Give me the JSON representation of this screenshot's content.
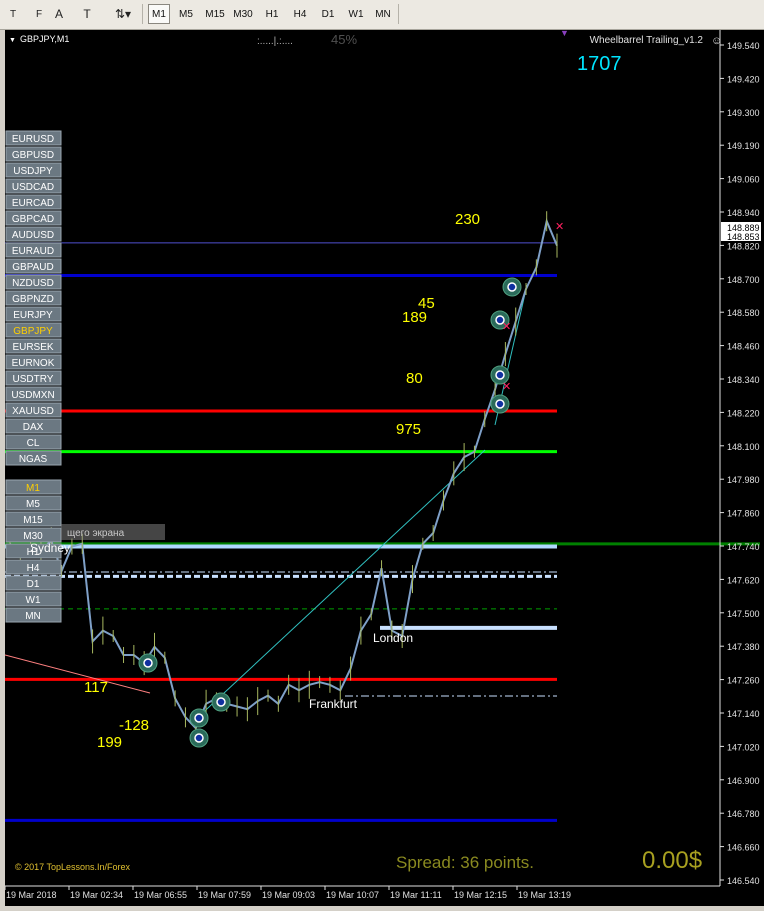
{
  "toolbar": {
    "tools": [
      {
        "icon": "text-label-icon",
        "glyph": "T"
      },
      {
        "icon": "fibonacci-icon",
        "glyph": "F"
      },
      {
        "icon": "text-icon",
        "glyph": "A"
      },
      {
        "icon": "text-box-icon",
        "glyph": "T"
      },
      {
        "icon": "arrows-dropdown-icon",
        "glyph": "⇅▾"
      }
    ],
    "timeframes": [
      "M1",
      "M5",
      "M15",
      "M30",
      "H1",
      "H4",
      "D1",
      "W1",
      "MN"
    ],
    "active_timeframe": "M1"
  },
  "chart": {
    "symbol": "GBPJPY,M1",
    "progress_label": "45%",
    "indicator": "Wheelbarrel Trailing_v1.2",
    "counter": "1707",
    "spread": "Spread: 36 points.",
    "profit": "0.00$",
    "copyright": "© 2017 TopLessons.In/Forex",
    "colors": {
      "background": "#000000",
      "candles": "#7fa0c8",
      "text_yellow": "#ffff00",
      "counter": "#00e5ff",
      "spread": "#8a8a20",
      "profit": "#a8a020"
    }
  },
  "symbols": [
    "EURUSD",
    "GBPUSD",
    "USDJPY",
    "USDCAD",
    "EURCAD",
    "GBPCAD",
    "AUDUSD",
    "EURAUD",
    "GBPAUD",
    "NZDUSD",
    "GBPNZD",
    "EURJPY",
    "GBPJPY",
    "EURSEK",
    "EURNOK",
    "USDTRY",
    "USDMXN",
    "XAUUSD",
    "DAX",
    "CL",
    "NGAS"
  ],
  "active_symbol": "GBPJPY",
  "timeframe_buttons": [
    "M1",
    "M5",
    "M15",
    "M30",
    "H1",
    "H4",
    "D1",
    "W1",
    "MN"
  ],
  "active_timeframe_button": "M1",
  "sessions": [
    "Sydney",
    "London",
    "Frankfurt"
  ],
  "hidden_text": "щего экрана",
  "chart_labels": [
    {
      "text": "230"
    },
    {
      "text": "45"
    },
    {
      "text": "189"
    },
    {
      "text": "80"
    },
    {
      "text": "975"
    },
    {
      "text": "117"
    },
    {
      "text": "-128"
    },
    {
      "text": "199"
    }
  ],
  "price_axis": [
    "149.540",
    "149.420",
    "149.300",
    "149.190",
    "149.060",
    "148.940",
    "148.820",
    "148.700",
    "148.580",
    "148.460",
    "148.340",
    "148.220",
    "148.100",
    "147.980",
    "147.860",
    "147.740",
    "147.620",
    "147.500",
    "147.380",
    "147.260",
    "147.140",
    "147.020",
    "146.900",
    "146.780",
    "146.660",
    "146.540"
  ],
  "price_markers": [
    "148.889",
    "148.853"
  ],
  "time_axis": [
    "19 Mar 2018",
    "19 Mar 02:34",
    "19 Mar 06:55",
    "19 Mar 07:59",
    "19 Mar 09:03",
    "19 Mar 10:07",
    "19 Mar 11:11",
    "19 Mar 12:15",
    "19 Mar 13:19"
  ],
  "chart_data": {
    "type": "line",
    "symbol": "GBPJPY",
    "timeframe": "M1",
    "ylim": [
      146.52,
      149.6
    ],
    "x": [
      0,
      1,
      2,
      3,
      4,
      5,
      6,
      7,
      8,
      9,
      10,
      11,
      12,
      13,
      14,
      15,
      16,
      17,
      18,
      19,
      20,
      21,
      22,
      23,
      24,
      25,
      26,
      27,
      28,
      29,
      30,
      31,
      32,
      33,
      34,
      35,
      36,
      37,
      38,
      39,
      40,
      41,
      42,
      43,
      44,
      45,
      46,
      47,
      48,
      49,
      50,
      51,
      52,
      53
    ],
    "values": [
      147.76,
      147.73,
      147.75,
      147.74,
      147.77,
      147.66,
      147.75,
      147.76,
      147.4,
      147.44,
      147.42,
      147.35,
      147.35,
      147.32,
      147.38,
      147.34,
      147.19,
      147.12,
      147.08,
      147.17,
      147.19,
      147.17,
      147.16,
      147.15,
      147.18,
      147.2,
      147.17,
      147.24,
      147.22,
      147.24,
      147.25,
      147.24,
      147.22,
      147.3,
      147.44,
      147.5,
      147.67,
      147.44,
      147.42,
      147.63,
      147.76,
      147.8,
      147.92,
      148.02,
      148.08,
      148.1,
      148.22,
      148.33,
      148.46,
      148.58,
      148.7,
      148.78,
      148.95,
      148.86
    ],
    "horizontal_levels": [
      148.87,
      148.75,
      148.25,
      148.1,
      147.76,
      147.75,
      147.64,
      147.52,
      147.45,
      147.26,
      146.74
    ]
  }
}
